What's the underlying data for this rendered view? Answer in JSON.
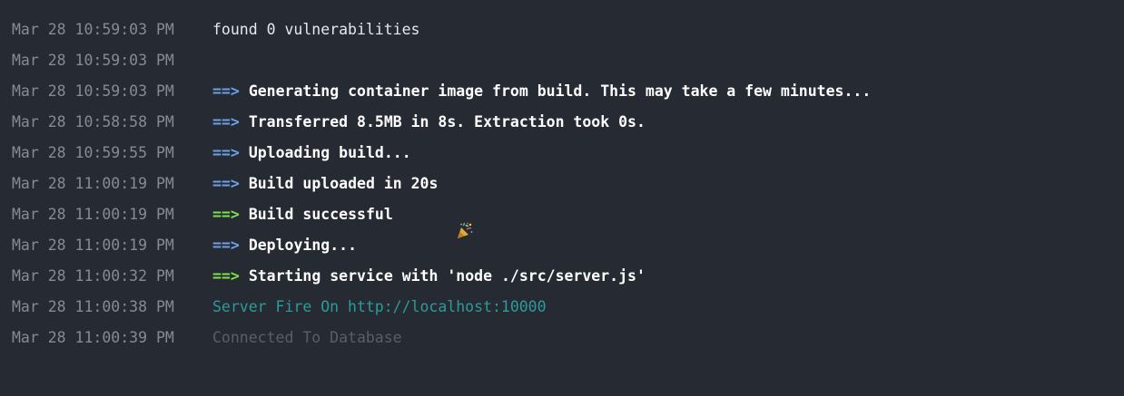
{
  "log": {
    "lines": [
      {
        "timestamp": "Mar 28 10:59:03 PM",
        "message": "found 0 vulnerabilities"
      },
      {
        "timestamp": "Mar 28 10:59:03 PM",
        "message": ""
      },
      {
        "timestamp": "Mar 28 10:59:03 PM",
        "arrow": "==>",
        "message": "Generating container image from build. This may take a few minutes..."
      },
      {
        "timestamp": "Mar 28 10:58:58 PM",
        "arrow": "==>",
        "message": "Transferred 8.5MB in 8s. Extraction took 0s."
      },
      {
        "timestamp": "Mar 28 10:59:55 PM",
        "arrow": "==>",
        "message": "Uploading build..."
      },
      {
        "timestamp": "Mar 28 11:00:19 PM",
        "arrow": "==>",
        "message": "Build uploaded in 20s"
      },
      {
        "timestamp": "Mar 28 11:00:19 PM",
        "arrow": "==>",
        "message": "Build successful",
        "icon": "party-popper-icon"
      },
      {
        "timestamp": "Mar 28 11:00:19 PM",
        "arrow": "==>",
        "message": "Deploying..."
      },
      {
        "timestamp": "Mar 28 11:00:32 PM",
        "arrow": "==>",
        "message": "Starting service with 'node ./src/server.js'"
      },
      {
        "timestamp": "Mar 28 11:00:38 PM",
        "message": "Server Fire On http://localhost:10000"
      },
      {
        "timestamp": "Mar 28 11:00:39 PM",
        "message": "Connected To Database"
      }
    ]
  },
  "colors": {
    "background": "#262a33",
    "timestamp": "#868a93",
    "arrow_info": "#6fa0e6",
    "arrow_success": "#7fe04a",
    "message_teal": "#2c9b9b",
    "message_dim": "#5a5e66"
  }
}
